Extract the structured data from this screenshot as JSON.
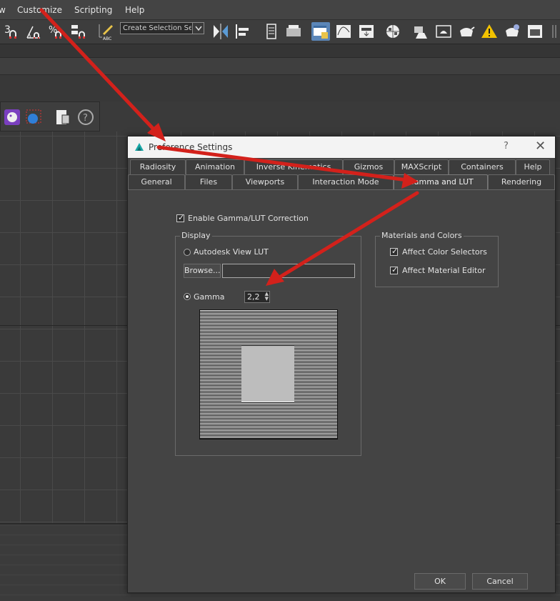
{
  "menu": [
    "w",
    "Customize",
    "Scripting",
    "Help"
  ],
  "toolbar": {
    "selection_set_placeholder": "Create Selection Se",
    "icons": [
      "snap-3-icon",
      "angle-snap-icon",
      "percent-snap-icon",
      "spinner-snap-icon",
      "edit-named-sets-icon",
      "mirror-icon",
      "align-icon",
      "layer-explorer-icon",
      "toggle-ribbon-icon",
      "scene-explorer-icon",
      "curve-editor-icon",
      "schematic-view-icon",
      "material-editor-icon",
      "render-setup-icon",
      "rendered-frame-window-icon",
      "render-production-icon",
      "render-iterative-icon",
      "warning-icon",
      "render-cloud-icon",
      "render-gallery-icon"
    ]
  },
  "dialog": {
    "title": "Preference Settings",
    "help": "?",
    "close": "✕",
    "tabs_row1": [
      "Radiosity",
      "Animation",
      "Inverse Kinematics",
      "Gizmos",
      "MAXScript",
      "Containers",
      "Help"
    ],
    "tabs_row2": [
      "General",
      "Files",
      "Viewports",
      "Interaction Mode",
      "Gamma and LUT",
      "Rendering"
    ],
    "active_tab": "Gamma and LUT",
    "enable_label": "Enable Gamma/LUT Correction",
    "enable_checked": true,
    "display": {
      "title": "Display",
      "lut_label": "Autodesk View LUT",
      "browse_label": "Browse...",
      "lut_path": "",
      "gamma_label": "Gamma",
      "gamma_value": "2,2",
      "mode": "Gamma"
    },
    "materials": {
      "title": "Materials and Colors",
      "color_selectors_label": "Affect Color Selectors",
      "color_selectors_checked": true,
      "material_editor_label": "Affect Material Editor",
      "material_editor_checked": true
    },
    "ok_label": "OK",
    "cancel_label": "Cancel"
  },
  "colors": {
    "annotation_arrow": "#d3211b",
    "active_toolbar": "#5b86b8"
  }
}
